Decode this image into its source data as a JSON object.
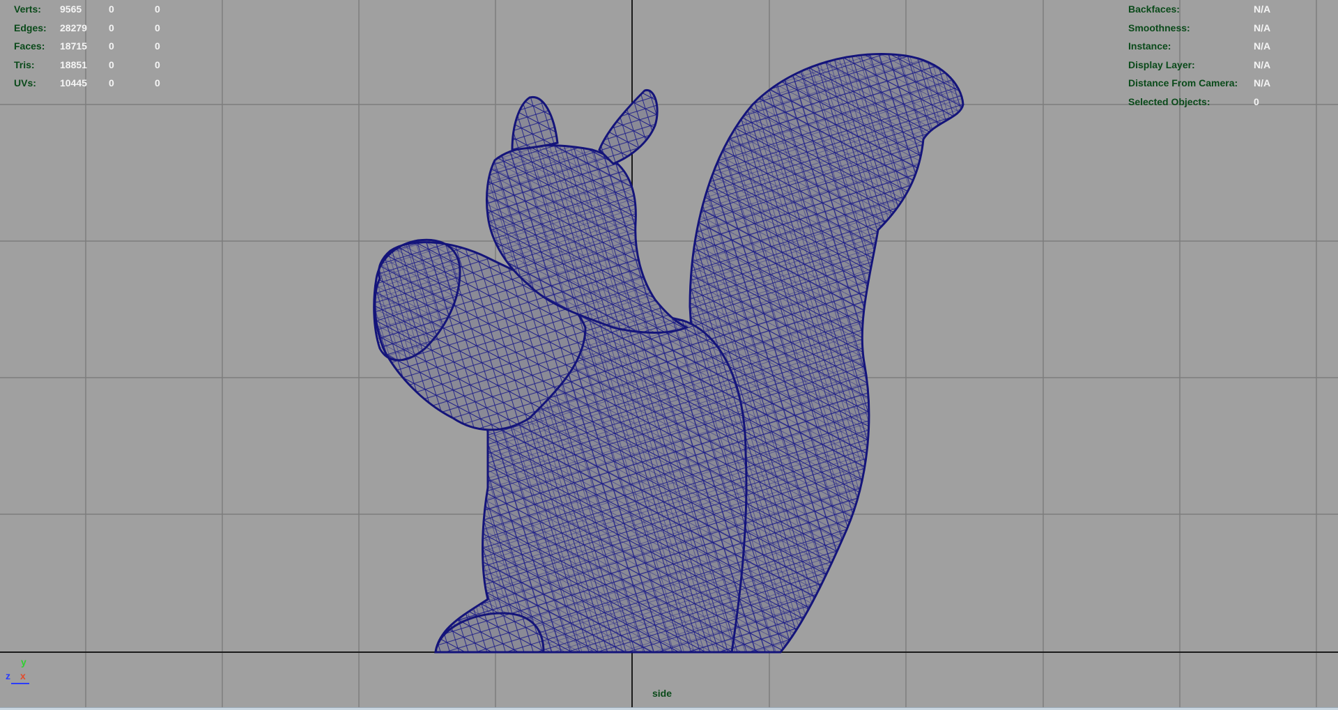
{
  "hud_left": {
    "rows": [
      {
        "label": "Verts:",
        "v1": "9565",
        "v2": "0",
        "v3": "0"
      },
      {
        "label": "Edges:",
        "v1": "28279",
        "v2": "0",
        "v3": "0"
      },
      {
        "label": "Faces:",
        "v1": "18715",
        "v2": "0",
        "v3": "0"
      },
      {
        "label": "Tris:",
        "v1": "18851",
        "v2": "0",
        "v3": "0"
      },
      {
        "label": "UVs:",
        "v1": "10445",
        "v2": "0",
        "v3": "0"
      }
    ]
  },
  "hud_right": {
    "rows": [
      {
        "label": "Backfaces:",
        "value": "N/A"
      },
      {
        "label": "Smoothness:",
        "value": "N/A"
      },
      {
        "label": "Instance:",
        "value": "N/A"
      },
      {
        "label": "Display Layer:",
        "value": "N/A"
      },
      {
        "label": "Distance From Camera:",
        "value": "N/A"
      },
      {
        "label": "Selected Objects:",
        "value": "0"
      }
    ]
  },
  "camera_label": "side",
  "axis_gizmo": {
    "y": "y",
    "z": "z",
    "x": "x"
  },
  "colors": {
    "viewport_bg": "#a0a0a0",
    "wire": "#1a1a88",
    "hud_label": "#0a4a1a",
    "hud_value": "#f5f5f5"
  }
}
